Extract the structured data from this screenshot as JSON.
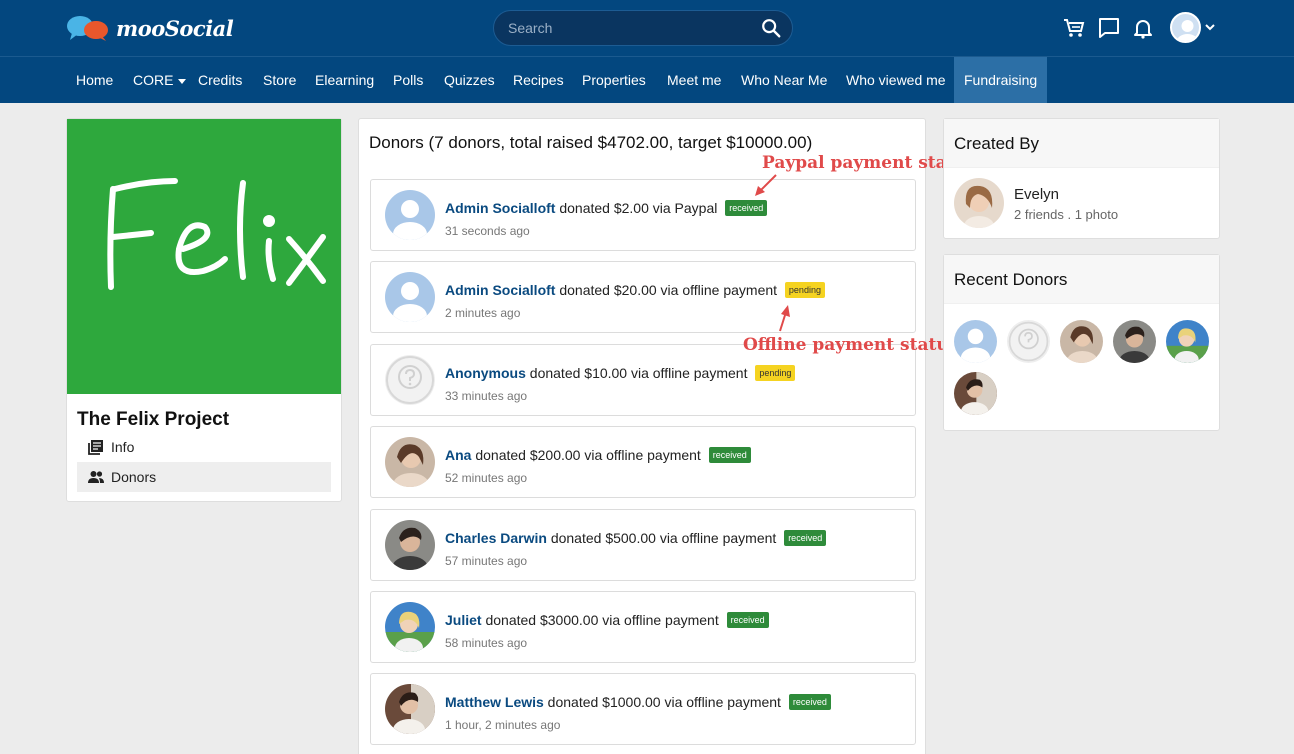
{
  "header": {
    "logo_text": "mooSocial",
    "search_placeholder": "Search",
    "icons": [
      "cart-icon",
      "chat-icon",
      "bell-icon",
      "user-avatar",
      "chevron-down-icon"
    ]
  },
  "nav": {
    "items": [
      {
        "label": "Home"
      },
      {
        "label": "CORE",
        "has_dropdown": true
      },
      {
        "label": "Credits"
      },
      {
        "label": "Store"
      },
      {
        "label": "Elearning"
      },
      {
        "label": "Polls"
      },
      {
        "label": "Quizzes"
      },
      {
        "label": "Recipes"
      },
      {
        "label": "Properties"
      },
      {
        "label": "Meet me"
      },
      {
        "label": "Who Near Me"
      },
      {
        "label": "Who viewed me"
      },
      {
        "label": "Fundraising",
        "active": true
      }
    ]
  },
  "project": {
    "cover_text": "Felix",
    "title": "The Felix Project",
    "links": [
      {
        "label": "Info"
      },
      {
        "label": "Donors",
        "active": true
      }
    ]
  },
  "donors_panel": {
    "title": "Donors (7 donors, total raised $4702.00, target $10000.00)",
    "donors": [
      {
        "name": "Admin Socialloft",
        "text": " donated $2.00 via Paypal",
        "status": "received",
        "time": "31 seconds ago",
        "avatar": "default"
      },
      {
        "name": "Admin Socialloft",
        "text": " donated $20.00 via offline payment",
        "status": "pending",
        "time": "2 minutes ago",
        "avatar": "default"
      },
      {
        "name": "Anonymous",
        "text": " donated $10.00 via offline payment",
        "status": "pending",
        "time": "33 minutes ago",
        "avatar": "anonymous"
      },
      {
        "name": "Ana",
        "text": " donated $200.00 via offline payment",
        "status": "received",
        "time": "52 minutes ago",
        "avatar": "photo"
      },
      {
        "name": "Charles Darwin",
        "text": " donated $500.00 via offline payment",
        "status": "received",
        "time": "57 minutes ago",
        "avatar": "photo"
      },
      {
        "name": "Juliet",
        "text": " donated $3000.00 via offline payment",
        "status": "received",
        "time": "58 minutes ago",
        "avatar": "photo"
      },
      {
        "name": "Matthew Lewis",
        "text": " donated $1000.00 via offline payment",
        "status": "received",
        "time": "1 hour, 2 minutes ago",
        "avatar": "photo"
      }
    ]
  },
  "annotations": {
    "paypal": "Paypal payment status",
    "offline": "Offline payment status"
  },
  "created_by": {
    "title": "Created By",
    "name": "Evelyn",
    "meta": "2 friends . 1 photo"
  },
  "recent_donors": {
    "title": "Recent Donors"
  },
  "colors": {
    "header_bg": "#03477f",
    "active_nav": "#2c6fa6",
    "received_badge": "#2e8b3a",
    "pending_badge": "#f5d321",
    "annotation": "#e04a4a",
    "cover_green": "#2ea83d"
  }
}
